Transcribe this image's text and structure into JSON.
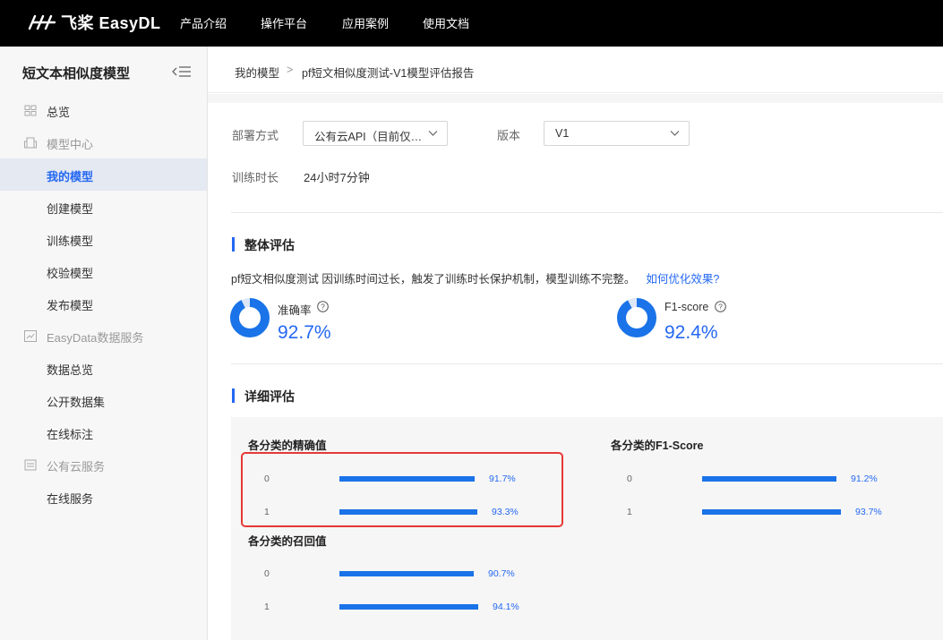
{
  "topnav": {
    "brand": "飞桨 EasyDL",
    "items": [
      "产品介绍",
      "操作平台",
      "应用案例",
      "使用文档"
    ]
  },
  "sidebar": {
    "title": "短文本相似度模型",
    "items": [
      {
        "label": "总览",
        "icon": "grid-icon",
        "type": "group"
      },
      {
        "label": "模型中心",
        "icon": "building-icon",
        "type": "group"
      },
      {
        "label": "我的模型",
        "type": "item",
        "active": true
      },
      {
        "label": "创建模型",
        "type": "item"
      },
      {
        "label": "训练模型",
        "type": "item"
      },
      {
        "label": "校验模型",
        "type": "item"
      },
      {
        "label": "发布模型",
        "type": "item"
      },
      {
        "label": "EasyData数据服务",
        "icon": "chart-icon",
        "type": "group"
      },
      {
        "label": "数据总览",
        "type": "item"
      },
      {
        "label": "公开数据集",
        "type": "item"
      },
      {
        "label": "在线标注",
        "type": "item"
      },
      {
        "label": "公有云服务",
        "icon": "cloud-server-icon",
        "type": "group"
      },
      {
        "label": "在线服务",
        "type": "item"
      }
    ]
  },
  "breadcrumb": {
    "home": "我的模型",
    "separator": ">",
    "current": "pf短文相似度测试-V1模型评估报告"
  },
  "config": {
    "deploy_label": "部署方式",
    "deploy_value": "公有云API（目前仅…",
    "version_label": "版本",
    "version_value": "V1",
    "duration_label": "训练时长",
    "duration_value": "24小时7分钟"
  },
  "overall": {
    "title": "整体评估",
    "notice": "pf短文相似度测试 因训练时间过长，触发了训练时长保护机制，模型训练不完整。",
    "notice_link": "如何优化效果?",
    "metrics": [
      {
        "label": "准确率",
        "value": "92.7%",
        "fraction": 0.927
      },
      {
        "label": "F1-score",
        "value": "92.4%",
        "fraction": 0.924
      }
    ]
  },
  "detail": {
    "title": "详细评估"
  },
  "chart_data": [
    {
      "type": "bar",
      "title": "各分类的精确值",
      "categories": [
        "0",
        "1"
      ],
      "values": [
        91.7,
        93.3
      ],
      "labels": [
        "91.7%",
        "93.3%"
      ]
    },
    {
      "type": "bar",
      "title": "各分类的F1-Score",
      "categories": [
        "0",
        "1"
      ],
      "values": [
        91.2,
        93.7
      ],
      "labels": [
        "91.2%",
        "93.7%"
      ]
    },
    {
      "type": "bar",
      "title": "各分类的召回值",
      "categories": [
        "0",
        "1"
      ],
      "values": [
        90.7,
        94.1
      ],
      "labels": [
        "90.7%",
        "94.1%"
      ]
    }
  ],
  "colors": {
    "accent": "#2468f2",
    "bar": "#1a73e8",
    "highlight": "#e53935"
  }
}
